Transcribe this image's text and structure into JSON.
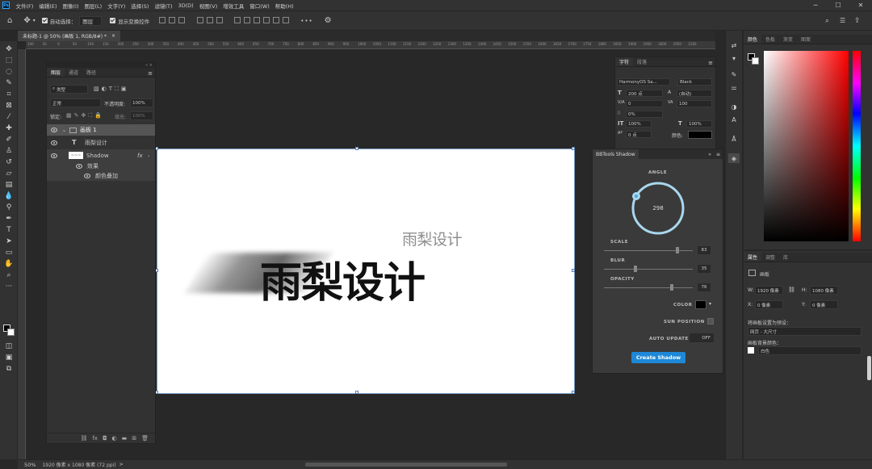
{
  "app": {
    "logo": "Ps"
  },
  "menu": [
    "文件(F)",
    "编辑(E)",
    "图像(I)",
    "图层(L)",
    "文字(Y)",
    "选择(S)",
    "滤镜(T)",
    "3D(D)",
    "视图(V)",
    "增效工具",
    "窗口(W)",
    "帮助(H)"
  ],
  "options": {
    "auto_select_label": "自动选择：",
    "auto_select_value": "图层",
    "show_transform_label": "显示变换控件",
    "more": "•••"
  },
  "document": {
    "tab_title": "未标题-1 @ 50% (画板 1, RGB/8#) *",
    "close": "×"
  },
  "ruler_ticks": [
    "100",
    "50",
    "0",
    "50",
    "100",
    "150",
    "200",
    "250",
    "300",
    "350",
    "400",
    "450",
    "500",
    "550",
    "600",
    "650",
    "700",
    "750",
    "800",
    "850",
    "900",
    "950",
    "1000",
    "1050",
    "1100",
    "1150",
    "1200",
    "1250",
    "1300",
    "1350",
    "1400",
    "1450",
    "1500",
    "1550",
    "1600",
    "1650",
    "1700",
    "1750",
    "1800",
    "1850",
    "1900",
    "1950",
    "2000",
    "2050",
    "2100"
  ],
  "canvas_text": {
    "small": "雨梨设计",
    "big": "雨梨设计"
  },
  "layers_panel": {
    "tabs": [
      "图层",
      "通道",
      "路径"
    ],
    "filter_label": "类型",
    "blend_mode": "正常",
    "opacity_label": "不透明度:",
    "opacity_value": "100%",
    "lock_label": "锁定:",
    "fill_label": "填充:",
    "fill_value": "100%",
    "rows": [
      {
        "name": "画板 1"
      },
      {
        "name": "雨梨设计"
      },
      {
        "name": "Shadow",
        "fx": "fx"
      },
      {
        "name": "效果"
      },
      {
        "name": "颜色叠加"
      }
    ]
  },
  "char_panel": {
    "tabs": [
      "字符",
      "段落"
    ],
    "font": "HarmonyOS Sa...",
    "style": "Black",
    "size": "200 点",
    "leading": "(自动)",
    "kerning": "0",
    "tracking": "100",
    "scale_v": "0%",
    "scale_h1": "100%",
    "scale_h2": "100%",
    "baseline": "0 点",
    "color_label": "颜色:"
  },
  "bbtools": {
    "title": "BBTools Shadow",
    "angle_label": "ANGLE",
    "angle_value": "298",
    "scale_label": "SCALE",
    "scale_value": "83",
    "blur_label": "BLUR",
    "blur_value": "35",
    "opacity_label": "OPACITY",
    "opacity_value": "76",
    "scale_level": 0.83,
    "blur_level": 0.35,
    "opacity_level": 0.76,
    "color_label": "COLOR",
    "sun_label": "SUN POSITION",
    "auto_label": "AUTO UPDATE",
    "auto_value": "OFF",
    "create_label": "Create Shadow",
    "accent": "#1e88d8"
  },
  "color_panel": {
    "tabs": [
      "颜色",
      "色板",
      "渐变",
      "图案"
    ]
  },
  "props_panel": {
    "tabs": [
      "属性",
      "调整",
      "库"
    ],
    "kind": "画板",
    "w_label": "W:",
    "w_value": "1920 像素",
    "h_label": "H:",
    "h_value": "1080 像素",
    "x_label": "X:",
    "x_value": "0 像素",
    "y_label": "Y:",
    "y_value": "0 像素",
    "preset_label": "将画板设置为预设：",
    "preset_value": "网页 - 大尺寸",
    "bg_label": "画板背景颜色：",
    "bg_value": "白色"
  },
  "status": {
    "zoom": "50%",
    "doc_info": "1920 像素 x 1080 像素 (72 ppi)",
    "arrow": ">"
  }
}
